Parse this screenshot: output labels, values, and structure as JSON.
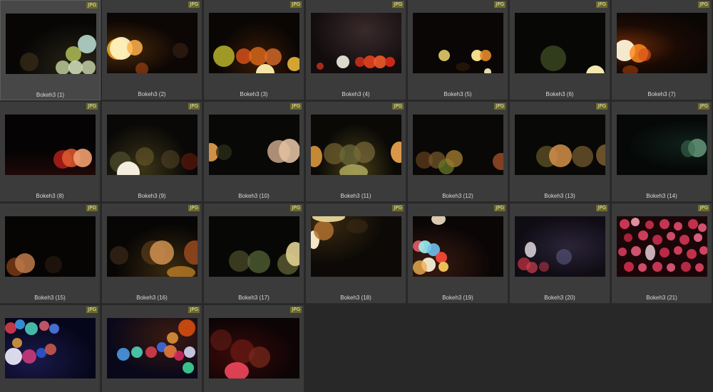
{
  "browser": {
    "items": [
      {
        "name": "Bokeh3 (1)",
        "badge": "JPG",
        "selected": true
      },
      {
        "name": "Bokeh3 (2)",
        "badge": "JPG"
      },
      {
        "name": "Bokeh3 (3)",
        "badge": "JPG"
      },
      {
        "name": "Bokeh3 (4)",
        "badge": "JPG"
      },
      {
        "name": "Bokeh3 (5)",
        "badge": "JPG"
      },
      {
        "name": "Bokeh3 (6)",
        "badge": "JPG"
      },
      {
        "name": "Bokeh3 (7)",
        "badge": "JPG"
      },
      {
        "name": "Bokeh3 (8)",
        "badge": "JPG"
      },
      {
        "name": "Bokeh3 (9)",
        "badge": "JPG"
      },
      {
        "name": "Bokeh3 (10)",
        "badge": "JPG"
      },
      {
        "name": "Bokeh3 (11)",
        "badge": "JPG"
      },
      {
        "name": "Bokeh3 (12)",
        "badge": "JPG"
      },
      {
        "name": "Bokeh3 (13)",
        "badge": "JPG"
      },
      {
        "name": "Bokeh3 (14)",
        "badge": "JPG"
      },
      {
        "name": "Bokeh3 (15)",
        "badge": "JPG"
      },
      {
        "name": "Bokeh3 (16)",
        "badge": "JPG"
      },
      {
        "name": "Bokeh3 (17)",
        "badge": "JPG"
      },
      {
        "name": "Bokeh3 (18)",
        "badge": "JPG"
      },
      {
        "name": "Bokeh3 (19)",
        "badge": "JPG"
      },
      {
        "name": "Bokeh3 (20)",
        "badge": "JPG"
      },
      {
        "name": "Bokeh3 (21)",
        "badge": "JPG"
      },
      {
        "name": "",
        "badge": "JPG"
      },
      {
        "name": "",
        "badge": "JPG"
      },
      {
        "name": "",
        "badge": "JPG"
      }
    ]
  }
}
